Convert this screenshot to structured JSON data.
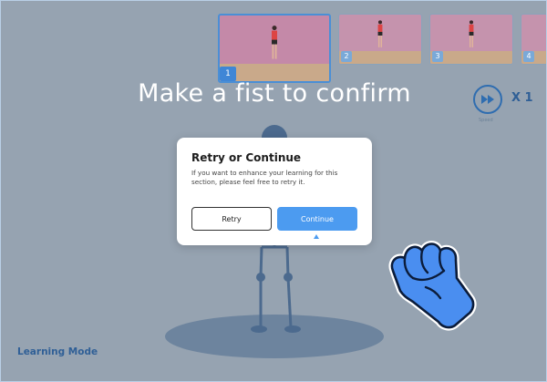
{
  "thumbnails": [
    {
      "number": "1",
      "active": true
    },
    {
      "number": "2",
      "active": false
    },
    {
      "number": "3",
      "active": false
    },
    {
      "number": "4",
      "active": false
    }
  ],
  "headline": "Make a fist to confirm",
  "speed": {
    "multiplier": "X 1",
    "label": "Speed",
    "icon": "fast-forward-icon"
  },
  "dialog": {
    "title": "Retry or Continue",
    "message": "If you want to enhance your learning for this section, please feel free to retry it.",
    "retry_label": "Retry",
    "continue_label": "Continue"
  },
  "gesture_icon": "fist-hand-icon",
  "mode_label": "Learning Mode",
  "colors": {
    "accent": "#4c9bf0",
    "overlay": "#3a4654",
    "dark_blue": "#2f5f96"
  }
}
